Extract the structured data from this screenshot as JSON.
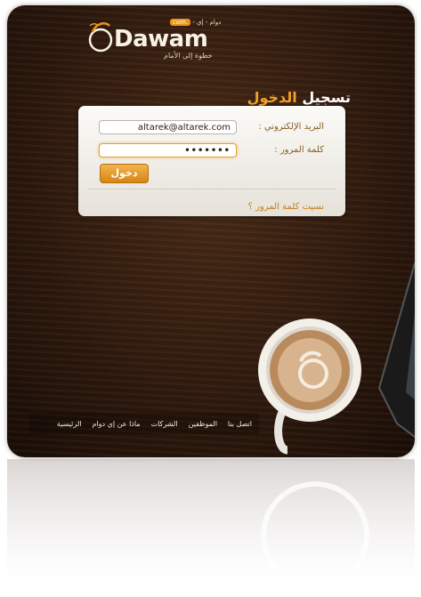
{
  "brand": {
    "name": "Dawam",
    "slogan": "خطوة إلى الأمام",
    "tag_prefix": "دوام - إي -",
    "tag_com": ".com"
  },
  "login": {
    "title_part1": "تسجيل",
    "title_part2": "الدخول",
    "email_label": "البريد الإلكتروني :",
    "email_value": "altarek@altarek.com",
    "password_label": "كلمة المرور :",
    "password_value": "•••••••",
    "submit_label": "دخول",
    "forgot_label": "نسيت كلمة المرور ؟"
  },
  "nav": {
    "items": [
      {
        "label": "الرئيسية"
      },
      {
        "label": "ماذا عن إي دوام"
      },
      {
        "label": "الشركات"
      },
      {
        "label": "الموظفين"
      },
      {
        "label": "اتصل بنا"
      }
    ]
  },
  "colors": {
    "accent": "#f0a224",
    "background": "#2f1a0e"
  }
}
